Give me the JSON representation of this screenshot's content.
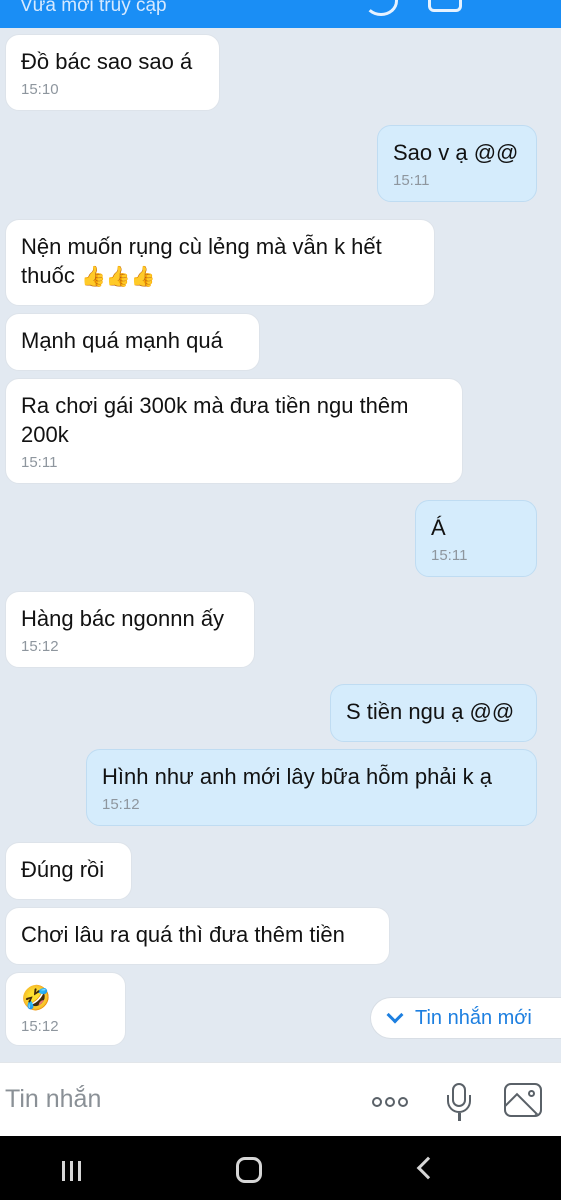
{
  "header": {
    "subtitle": "Vừa mới truy cập",
    "call_icon": "phone-icon",
    "video_icon": "video-icon"
  },
  "messages": [
    {
      "side": "in",
      "text": "Đồ bác sao sao á",
      "time": "15:10"
    },
    {
      "side": "out",
      "text": "Sao v ạ @@",
      "time": "15:11"
    },
    {
      "side": "in",
      "text": "Nện muốn rụng cù lẻng mà vẫn k hết thuốc",
      "emoji": "👍👍👍",
      "time": ""
    },
    {
      "side": "in",
      "text": "Mạnh quá mạnh quá",
      "time": ""
    },
    {
      "side": "in",
      "text": "Ra chơi gái 300k mà đưa tiền ngu thêm 200k",
      "time": "15:11"
    },
    {
      "side": "out",
      "text": "Á",
      "time": "15:11"
    },
    {
      "side": "in",
      "text": "Hàng bác ngonnn ấy",
      "time": "15:12"
    },
    {
      "side": "out",
      "text": "S tiền ngu ạ @@",
      "time": ""
    },
    {
      "side": "out",
      "text": "Hình như anh mới lây bữa hỗm phải k ạ",
      "time": "15:12"
    },
    {
      "side": "in",
      "text": "Đúng rồi",
      "time": ""
    },
    {
      "side": "in",
      "text": "Chơi lâu ra quá thì đưa thêm tiền",
      "time": ""
    },
    {
      "side": "in",
      "text": "",
      "emoji": "🤣",
      "time": "15:12"
    }
  ],
  "new_messages_label": "Tin nhắn mới",
  "composer": {
    "placeholder": "Tin nhắn",
    "more_icon": "more-icon",
    "mic_icon": "microphone-icon",
    "image_icon": "image-icon"
  },
  "nav": {
    "recent_icon": "recent-apps-icon",
    "home_icon": "home-icon",
    "back_icon": "back-icon"
  },
  "colors": {
    "header": "#1a8ef5",
    "background": "#e2e9f1",
    "incoming_bubble": "#ffffff",
    "outgoing_bubble": "#d5ecfc",
    "accent": "#1d7fe0"
  }
}
